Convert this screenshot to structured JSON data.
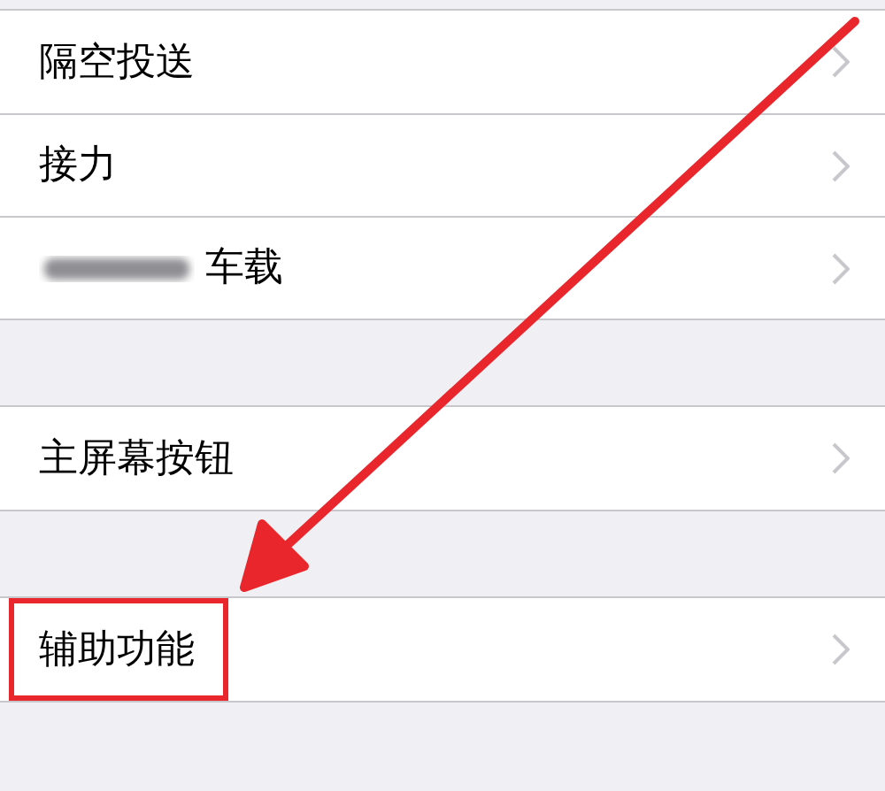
{
  "groups": [
    {
      "rows": [
        {
          "label": "隔空投送",
          "blurred_prefix": false,
          "highlighted": false
        },
        {
          "label": "接力",
          "blurred_prefix": false,
          "highlighted": false
        },
        {
          "label": "车载",
          "blurred_prefix": true,
          "highlighted": false
        }
      ]
    },
    {
      "rows": [
        {
          "label": "主屏幕按钮",
          "blurred_prefix": false,
          "highlighted": false
        }
      ]
    },
    {
      "rows": [
        {
          "label": "辅助功能",
          "blurred_prefix": false,
          "highlighted": true
        }
      ]
    }
  ],
  "annotation_arrow": true
}
